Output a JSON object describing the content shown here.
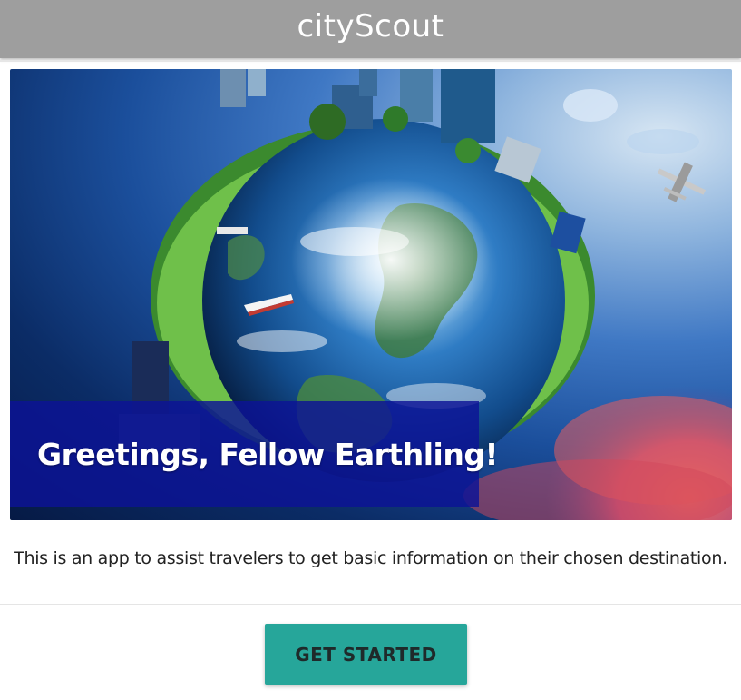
{
  "header": {
    "title": "cityScout"
  },
  "hero": {
    "image_description_icon": "earth-city-illustration",
    "caption": "Greetings, Fellow Earthling!",
    "caption_bg_color": "#0c1296"
  },
  "main": {
    "description": "This is an app to assist travelers to get basic information on their chosen destination.",
    "cta_label": "GET STARTED",
    "cta_color": "#26a69a"
  },
  "colors": {
    "header_bg": "#9e9e9e",
    "accent": "#26a69a"
  }
}
